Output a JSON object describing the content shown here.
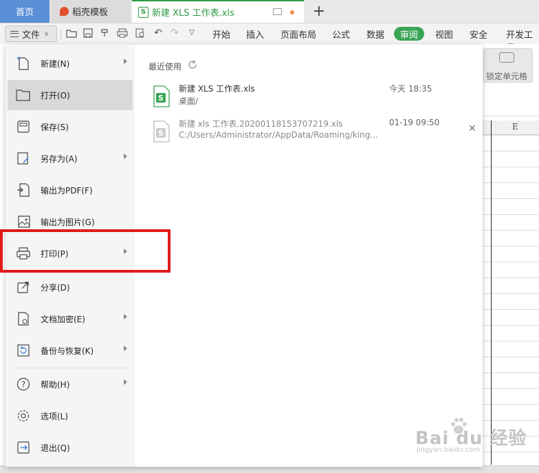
{
  "tabbar": {
    "home_label": "首页",
    "template_label": "稻壳模板",
    "file_tab_label": "新建 XLS 工作表.xls",
    "add_tab": "+"
  },
  "ribbon": {
    "file_button_label": "文件",
    "tabs": [
      "开始",
      "插入",
      "页面布局",
      "公式",
      "数据",
      "审阅",
      "视图",
      "安全",
      "开发工具"
    ],
    "active_tab": "审阅",
    "lock_cell_label": "锁定单元格"
  },
  "sheet": {
    "column_header": "E"
  },
  "file_menu": {
    "items": [
      {
        "label": "新建(N)",
        "icon": "new-file-icon",
        "has_submenu": true
      },
      {
        "label": "打开(O)",
        "icon": "folder-open-icon",
        "has_submenu": false
      },
      {
        "label": "保存(S)",
        "icon": "save-icon",
        "has_submenu": false
      },
      {
        "label": "另存为(A)",
        "icon": "save-as-icon",
        "has_submenu": true
      },
      {
        "label": "输出为PDF(F)",
        "icon": "pdf-export-icon",
        "has_submenu": false
      },
      {
        "label": "输出为图片(G)",
        "icon": "image-export-icon",
        "has_submenu": false
      },
      {
        "label": "打印(P)",
        "icon": "printer-icon",
        "has_submenu": true
      },
      {
        "label": "分享(D)",
        "icon": "share-icon",
        "has_submenu": false
      },
      {
        "label": "文档加密(E)",
        "icon": "encrypt-icon",
        "has_submenu": true
      },
      {
        "label": "备份与恢复(K)",
        "icon": "backup-icon",
        "has_submenu": true
      },
      {
        "label": "帮助(H)",
        "icon": "help-icon",
        "has_submenu": true
      },
      {
        "label": "选项(L)",
        "icon": "settings-icon",
        "has_submenu": false
      },
      {
        "label": "退出(Q)",
        "icon": "exit-icon",
        "has_submenu": false
      }
    ],
    "active_item": "打开(O)",
    "recent": {
      "title": "最近使用",
      "files": [
        {
          "name": "新建 XLS 工作表.xls",
          "path": "桌面/",
          "time": "今天 18:35"
        },
        {
          "name": "新建 xls 工作表.20200118153707219.xls",
          "path": "C:/Users/Administrator/AppData/Roaming/king...",
          "time": "01-19 09:50",
          "close": "✕"
        }
      ]
    }
  },
  "watermark": {
    "brand": "Bai du 经验",
    "url": "jingyan.baidu.com"
  },
  "colors": {
    "accent_green": "#3aa556",
    "home_tab_blue": "#5b8fd6",
    "highlight_red": "#e01a1a"
  }
}
